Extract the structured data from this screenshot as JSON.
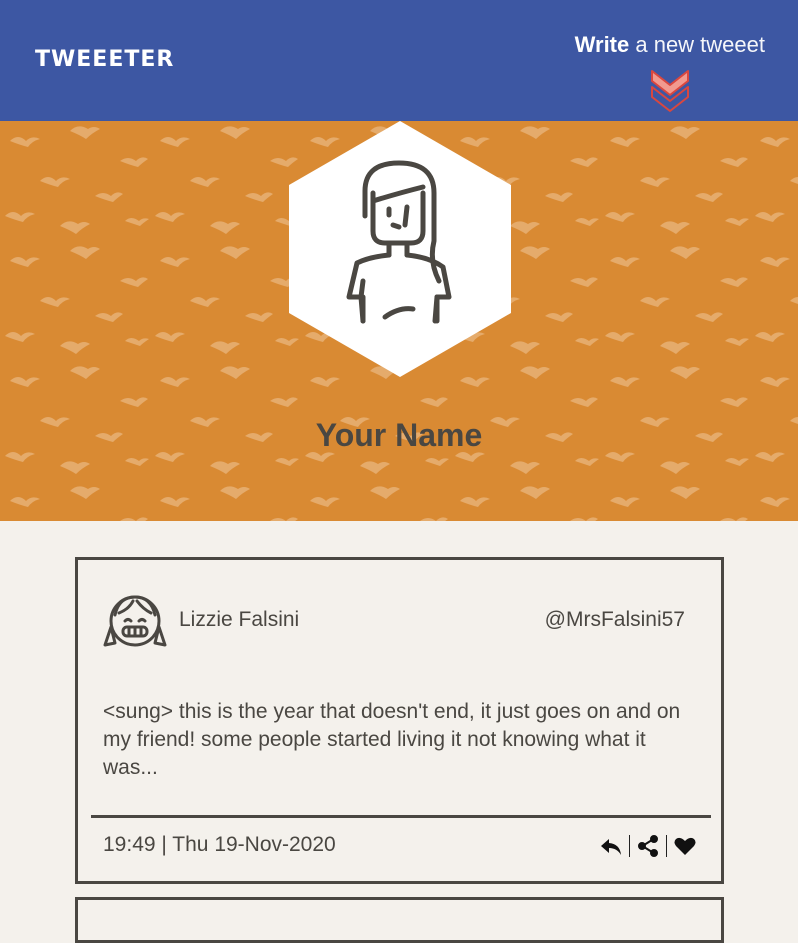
{
  "header": {
    "brand": "TWEEETER",
    "write_strong": "Write",
    "write_rest": " a new tweeet",
    "chevron_icon": "double-chevron-down-icon",
    "colors": {
      "bar": "#3d57a3",
      "chevron": "#d9473f"
    }
  },
  "profile": {
    "name": "Your Name",
    "avatar_icon": "woman-avatar-icon",
    "banner_color": "#d98a33"
  },
  "tweets": [
    {
      "author": "Lizzie Falsini",
      "handle": "@MrsFalsini57",
      "avatar_icon": "girl-avatar-icon",
      "text": "<sung> this is the year that doesn't end, it just goes on and on my friend! some people started living it not knowing what it was...",
      "timestamp": "19:49 | Thu 19-Nov-2020",
      "actions": [
        "reply-icon",
        "share-icon",
        "heart-icon"
      ]
    }
  ]
}
